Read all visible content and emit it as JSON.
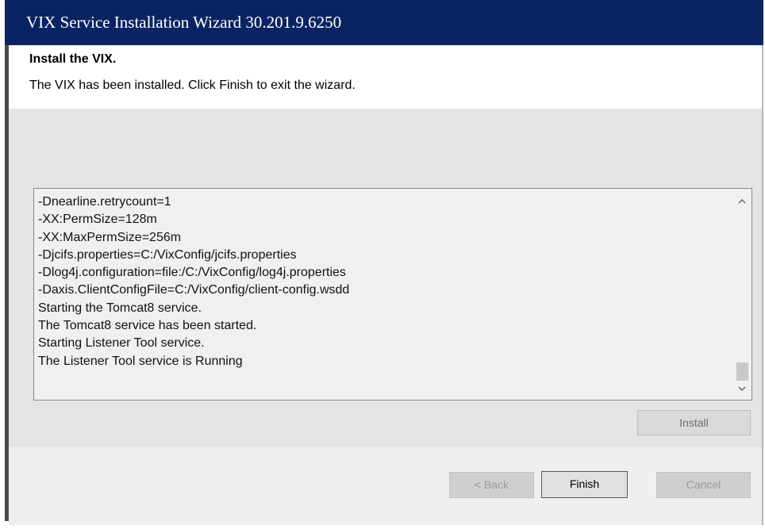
{
  "window": {
    "title": "VIX Service Installation Wizard 30.201.9.6250"
  },
  "header": {
    "heading": "Install the VIX.",
    "subtitle": "The VIX has been installed. Click Finish to exit the wizard."
  },
  "log": {
    "lines": [
      "-Dnearline.retrycount=1",
      "-XX:PermSize=128m",
      "-XX:MaxPermSize=256m",
      "-Djcifs.properties=C:/VixConfig/jcifs.properties",
      "-Dlog4j.configuration=file:/C:/VixConfig/log4j.properties",
      "-Daxis.ClientConfigFile=C:/VixConfig/client-config.wsdd",
      "Starting the Tomcat8 service.",
      "The Tomcat8 service has been started.",
      "Starting Listener Tool service.",
      "The Listener Tool service is Running"
    ],
    "scroll_up_icon": "chevron-up-icon",
    "scroll_down_icon": "chevron-down-icon"
  },
  "buttons": {
    "install": "Install",
    "back": "< Back",
    "finish": "Finish",
    "cancel": "Cancel"
  },
  "colors": {
    "titlebar": "#0a2463",
    "body": "#e4e4e4",
    "footer": "#efefef"
  }
}
